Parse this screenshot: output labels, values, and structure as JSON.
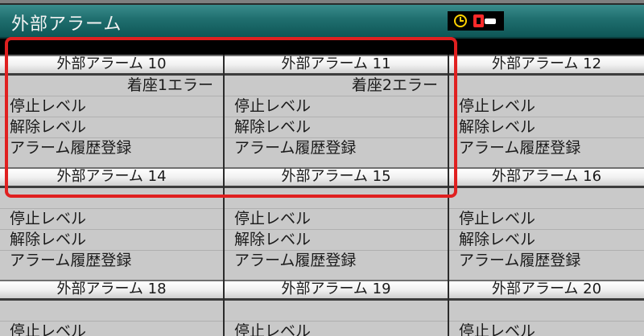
{
  "window": {
    "title": "外部アラーム"
  },
  "alarms": [
    {
      "header": "外部アラーム 10",
      "name": "着座1エラー",
      "stop_level": "停止レベル",
      "release_level": "解除レベル",
      "history": "アラーム履歴登録"
    },
    {
      "header": "外部アラーム 11",
      "name": "着座2エラー",
      "stop_level": "停止レベル",
      "release_level": "解除レベル",
      "history": "アラーム履歴登録"
    },
    {
      "header": "外部アラーム 12",
      "name": "",
      "stop_level": "停止レベル",
      "release_level": "解除レベル",
      "history": "アラーム履歴登録"
    },
    {
      "header": "外部アラーム 14",
      "name": "",
      "stop_level": "停止レベル",
      "release_level": "解除レベル",
      "history": "アラーム履歴登録"
    },
    {
      "header": "外部アラーム 15",
      "name": "",
      "stop_level": "停止レベル",
      "release_level": "解除レベル",
      "history": "アラーム履歴登録"
    },
    {
      "header": "外部アラーム 16",
      "name": "",
      "stop_level": "停止レベル",
      "release_level": "解除レベル",
      "history": "アラーム履歴登録"
    },
    {
      "header": "外部アラーム 18",
      "name": "",
      "stop_level": "停止レベル",
      "release_level": "",
      "history": ""
    },
    {
      "header": "外部アラーム 19",
      "name": "",
      "stop_level": "停止レベル",
      "release_level": "",
      "history": ""
    },
    {
      "header": "外部アラーム 20",
      "name": "",
      "stop_level": "停止レベル",
      "release_level": "",
      "history": ""
    }
  ],
  "icons": {
    "clock": "clock-icon",
    "key": "key-icon"
  },
  "colors": {
    "titlebar": "#1f6e6e",
    "highlight": "#e02020",
    "panel": "#c9c9c9"
  }
}
